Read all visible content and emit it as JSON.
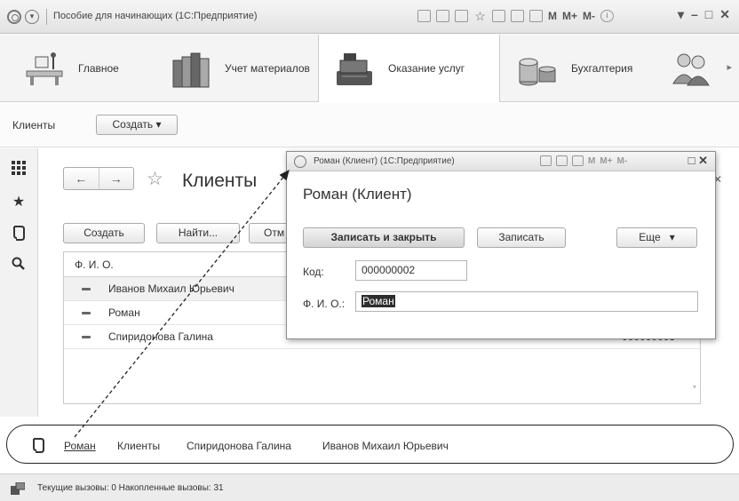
{
  "window": {
    "title": "Пособие для начинающих (1С:Предприятие)",
    "toolbar_m": "M",
    "toolbar_mplus": "M+",
    "toolbar_mminus": "M-"
  },
  "sections": [
    {
      "label": "Главное",
      "icon": "desk-icon"
    },
    {
      "label": "Учет материалов",
      "icon": "books-icon"
    },
    {
      "label": "Оказание услуг",
      "icon": "cash-register-icon"
    },
    {
      "label": "Бухгалтерия",
      "icon": "coins-icon"
    }
  ],
  "commandbar": {
    "title": "Клиенты",
    "create_label": "Создать"
  },
  "form": {
    "title": "Клиенты",
    "create_label": "Создать",
    "find_label": "Найти...",
    "cancel_label": "Отм",
    "column_fio": "Ф. И. О.",
    "rows": [
      {
        "name": "Иванов Михаил Юрьевич",
        "code": ""
      },
      {
        "name": "Роман",
        "code": ""
      },
      {
        "name": "Спиридонова Галина",
        "code": "000000003"
      }
    ]
  },
  "history": {
    "items": [
      "Роман",
      "Клиенты",
      "Спиридонова Галина",
      "Иванов Михаил Юрьевич"
    ]
  },
  "status": {
    "text": "Текущие вызовы: 0  Накопленные вызовы: 31"
  },
  "popup": {
    "window_title": "Роман (Клиент) (1С:Предприятие)",
    "heading": "Роман (Клиент)",
    "save_close_label": "Записать и закрыть",
    "save_label": "Записать",
    "more_label": "Еще",
    "code_label": "Код:",
    "code_value": "000000002",
    "fio_label": "Ф. И. О.:",
    "fio_value": "Роман",
    "m": "M",
    "mplus": "M+",
    "mminus": "M-"
  }
}
